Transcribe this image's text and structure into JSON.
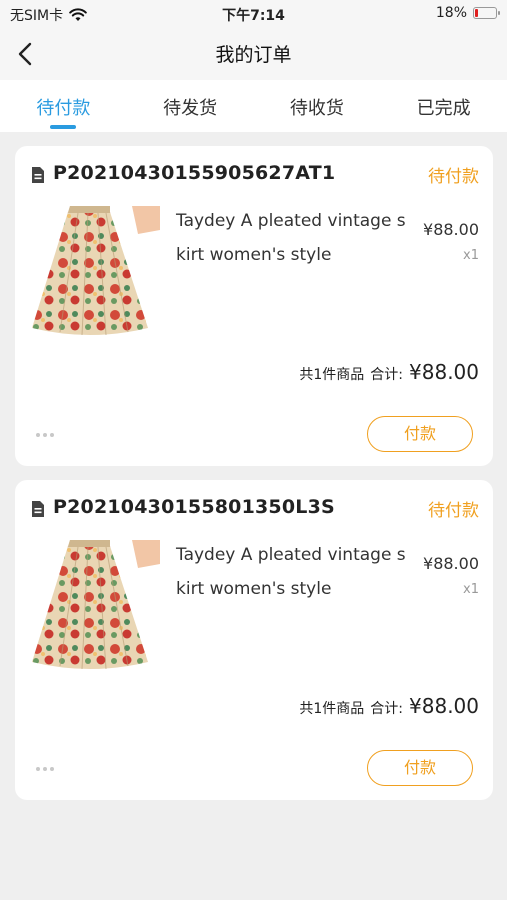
{
  "status_bar": {
    "carrier": "无SIM卡",
    "time": "下午7:14",
    "battery": "18%"
  },
  "nav": {
    "title": "我的订单"
  },
  "tabs": [
    {
      "label": "待付款"
    },
    {
      "label": "待发货"
    },
    {
      "label": "待收货"
    },
    {
      "label": "已完成"
    }
  ],
  "orders": [
    {
      "order_no": "P20210430155905627AT1",
      "status": "待付款",
      "product_title": "Taydey A pleated vintage skirt women's style",
      "price": "¥88.00",
      "qty": "x1",
      "count_text": "共1件商品",
      "total_label": "合计:",
      "total": "¥88.00",
      "pay_label": "付款"
    },
    {
      "order_no": "P20210430155801350L3S",
      "status": "待付款",
      "product_title": "Taydey A pleated vintage skirt women's style",
      "price": "¥88.00",
      "qty": "x1",
      "count_text": "共1件商品",
      "total_label": "合计:",
      "total": "¥88.00",
      "pay_label": "付款"
    }
  ],
  "colors": {
    "accent_blue": "#2a9be0",
    "accent_orange": "#f0a020"
  }
}
